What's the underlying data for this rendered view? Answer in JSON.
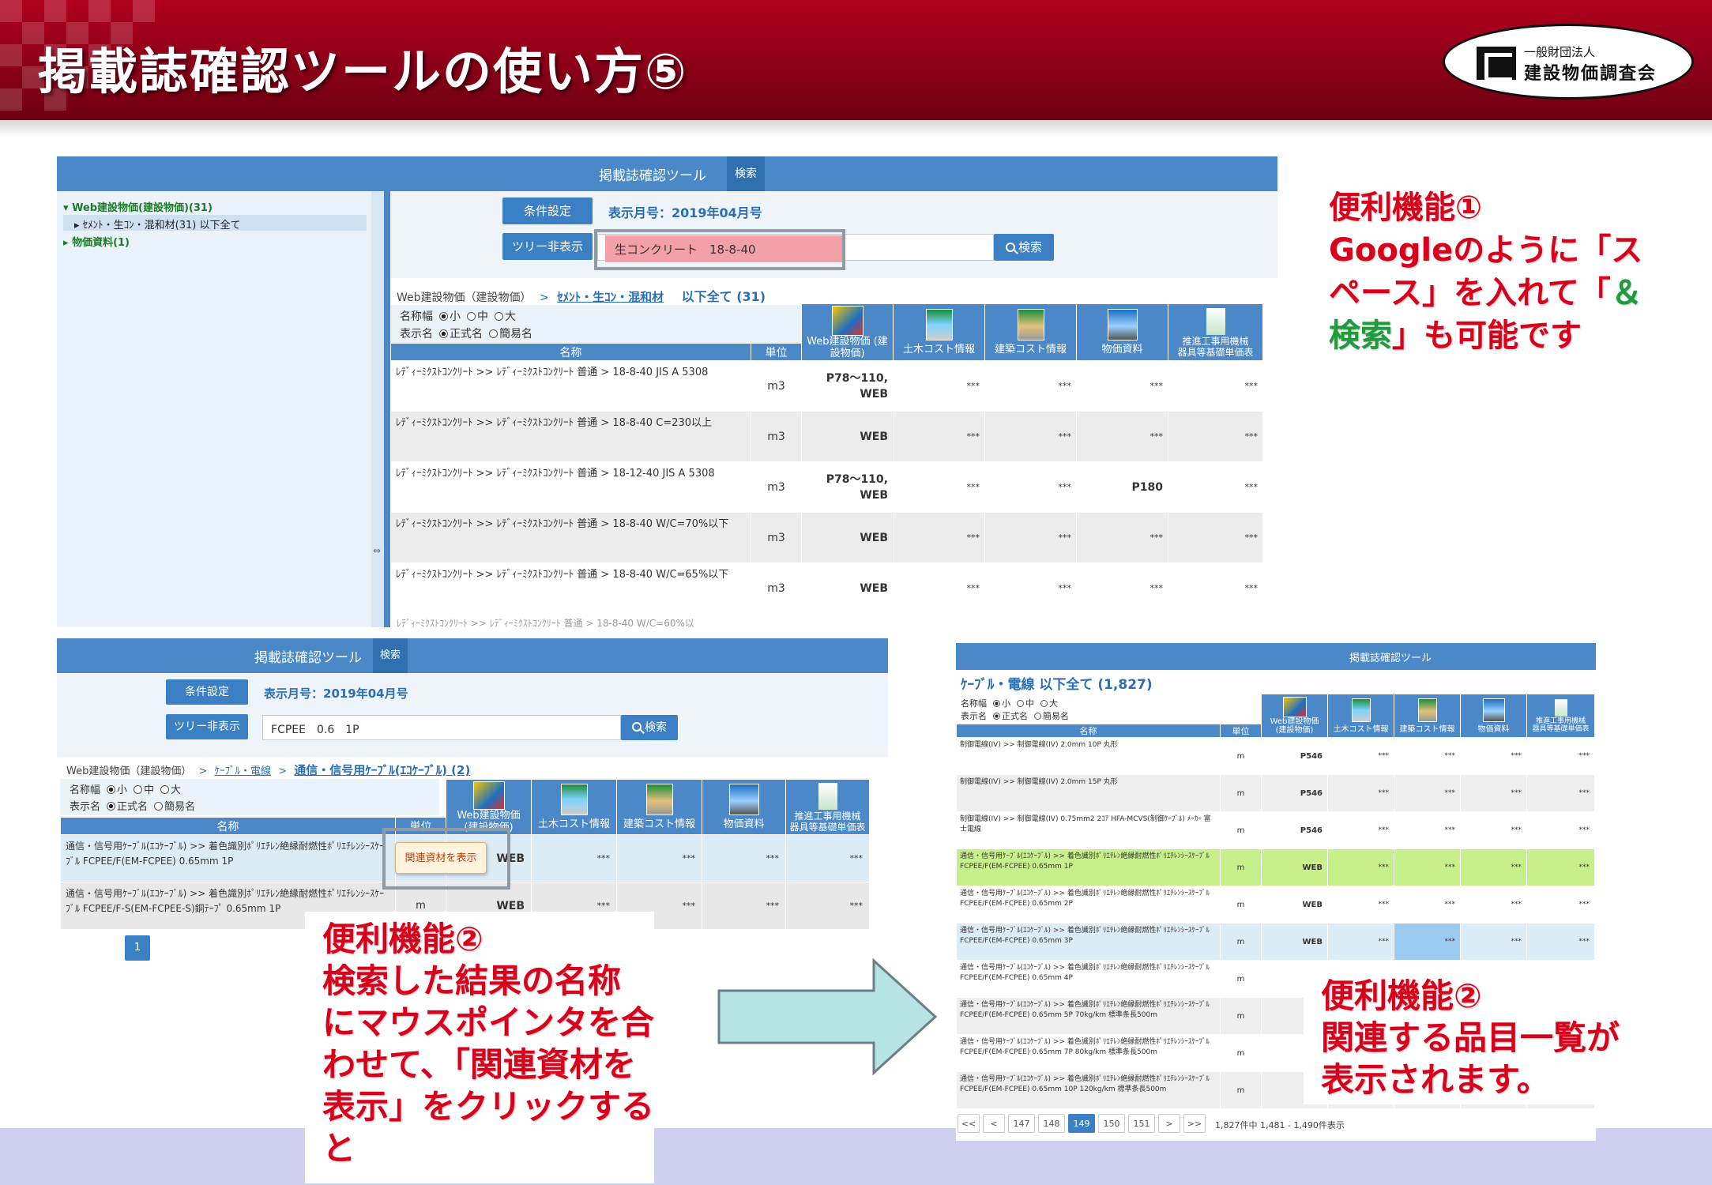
{
  "header": {
    "title": "掲載誌確認ツールの使い方⑤",
    "logo": {
      "line1": "一般財団法人",
      "line2": "建設物価調査会"
    }
  },
  "colors": {
    "header_red": "#9a001a",
    "tool_blue": "#4a88c7",
    "callout_red": "#d8001a",
    "callout_green": "#1f9a3c"
  },
  "tool1": {
    "title": "掲載誌確認ツール",
    "search_tab": "検索",
    "tree": {
      "root": "Web建設物価(建設物価)(31)",
      "child": "ｾﾒﾝﾄ・生ｺﾝ・混和材(31) 以下全て",
      "other": "物価資料(1)"
    },
    "condition_button": "条件設定",
    "month_label": "表示月号：2019年04月号",
    "tree_toggle_button": "ツリー非表示",
    "search_value": "生コンクリート　18-8-40",
    "search_button": "検索",
    "breadcrumb_root": "Web建設物価（建設物価）",
    "breadcrumb_sep": ">",
    "breadcrumb_cat": "ｾﾒﾝﾄ・生ｺﾝ・混和材",
    "breadcrumb_all": "以下全て (31)",
    "name_width_label": "名称幅",
    "name_width_opts": [
      "小",
      "中",
      "大"
    ],
    "display_label": "表示名",
    "display_opts": [
      "正式名",
      "簡易名"
    ],
    "col_name": "名称",
    "col_unit": "単位",
    "col_pubs": [
      "Web建設物価\n(建設物価)",
      "土木コスト情報",
      "建築コスト情報",
      "物価資料",
      "推進工事用機械\n器具等基礎単価表"
    ],
    "rows": [
      {
        "name": "ﾚﾃﾞｨｰﾐｸｽﾄｺﾝｸﾘｰﾄ >> ﾚﾃﾞｨｰﾐｸｽﾄｺﾝｸﾘｰﾄ 普通 > 18-8-40 JIS A 5308",
        "unit": "m3",
        "web": "P78～110,\nWEB",
        "doboku": "***",
        "kenchiku": "***",
        "bukka": "***",
        "suishin": "***"
      },
      {
        "name": "ﾚﾃﾞｨｰﾐｸｽﾄｺﾝｸﾘｰﾄ >> ﾚﾃﾞｨｰﾐｸｽﾄｺﾝｸﾘｰﾄ 普通 > 18-8-40 C=230以上",
        "unit": "m3",
        "web": "WEB",
        "doboku": "***",
        "kenchiku": "***",
        "bukka": "***",
        "suishin": "***"
      },
      {
        "name": "ﾚﾃﾞｨｰﾐｸｽﾄｺﾝｸﾘｰﾄ >> ﾚﾃﾞｨｰﾐｸｽﾄｺﾝｸﾘｰﾄ 普通 > 18-12-40 JIS A 5308",
        "unit": "m3",
        "web": "P78～110,\nWEB",
        "doboku": "***",
        "kenchiku": "***",
        "bukka": "P180",
        "suishin": "***"
      },
      {
        "name": "ﾚﾃﾞｨｰﾐｸｽﾄｺﾝｸﾘｰﾄ >> ﾚﾃﾞｨｰﾐｸｽﾄｺﾝｸﾘｰﾄ 普通 > 18-8-40 W/C=70%以下",
        "unit": "m3",
        "web": "WEB",
        "doboku": "***",
        "kenchiku": "***",
        "bukka": "***",
        "suishin": "***"
      },
      {
        "name": "ﾚﾃﾞｨｰﾐｸｽﾄｺﾝｸﾘｰﾄ >> ﾚﾃﾞｨｰﾐｸｽﾄｺﾝｸﾘｰﾄ 普通 > 18-8-40 W/C=65%以下",
        "unit": "m3",
        "web": "WEB",
        "doboku": "***",
        "kenchiku": "***",
        "bukka": "***",
        "suishin": "***"
      }
    ]
  },
  "tool2": {
    "title": "掲載誌確認ツール",
    "search_tab": "検索",
    "condition_button": "条件設定",
    "month_label": "表示月号：2019年04月号",
    "tree_toggle_button": "ツリー非表示",
    "search_value": "FCPEE　0.6　1P",
    "search_button": "検索",
    "breadcrumb_root": "Web建設物価（建設物価）",
    "breadcrumb_sep": ">",
    "breadcrumb_cat": "ｹｰﾌﾞﾙ・電線",
    "breadcrumb_sub": "通信・信号用ｹｰﾌﾞﾙ(ｴｺｹｰﾌﾞﾙ) (2)",
    "name_width_label": "名称幅",
    "name_width_opts": [
      "小",
      "中",
      "大"
    ],
    "display_label": "表示名",
    "display_opts": [
      "正式名",
      "簡易名"
    ],
    "col_name": "名称",
    "col_unit": "単位",
    "col_pubs": [
      "Web建設物価\n(建設物価)",
      "土木コスト情報",
      "建築コスト情報",
      "物価資料",
      "推進工事用機械\n器具等基礎単価表"
    ],
    "related_popup": "関連資材を表示",
    "rows": [
      {
        "name": "通信・信号用ｹｰﾌﾞﾙ(ｴｺｹｰﾌﾞﾙ) >> 着色識別ﾎﾟﾘｴﾁﾚﾝ絶縁耐燃性ﾎﾟﾘｴﾁﾚﾝｼｰｽｹｰﾌﾞﾙ FCPEE/F(EM-FCPEE) 0.65mm 1P",
        "unit": "m",
        "web": "WEB",
        "doboku": "***",
        "kenchiku": "***",
        "bukka": "***",
        "suishin": "***"
      },
      {
        "name": "通信・信号用ｹｰﾌﾞﾙ(ｴｺｹｰﾌﾞﾙ) >> 着色識別ﾎﾟﾘｴﾁﾚﾝ絶縁耐燃性ﾎﾟﾘｴﾁﾚﾝｼｰｽｹｰﾌﾞﾙ FCPEE/F-S(EM-FCPEE-S)銅ﾃｰﾌﾟ 0.65mm 1P",
        "unit": "m",
        "web": "WEB",
        "doboku": "***",
        "kenchiku": "***",
        "bukka": "***",
        "suishin": "***"
      }
    ],
    "page": "1"
  },
  "tool3": {
    "title": "掲載誌確認ツール",
    "heading": "ｹｰﾌﾞﾙ・電線 以下全て (1,827)",
    "name_width_label": "名称幅",
    "name_width_opts": [
      "小",
      "中",
      "大"
    ],
    "display_label": "表示名",
    "display_opts": [
      "正式名",
      "簡易名"
    ],
    "col_name": "名称",
    "col_unit": "単位",
    "col_pubs": [
      "Web建設物価\n(建設物価)",
      "土木コスト情報",
      "建築コスト情報",
      "物価資料",
      "推進工事用機械\n器具等基礎単価表"
    ],
    "rows": [
      {
        "name": "制御電線(IV) >> 制御電線(IV) 2.0mm 10P 丸形",
        "unit": "m",
        "web": "P546",
        "hl": ""
      },
      {
        "name": "制御電線(IV) >> 制御電線(IV) 2.0mm 15P 丸形",
        "unit": "m",
        "web": "P546",
        "hl": ""
      },
      {
        "name": "制御電線(IV) >> 制御電線(IV) 0.75mm2 2ｺｱ HFA-MCVS(制御ｹｰﾌﾞﾙ) ﾒｰｶｰ 富士電線",
        "unit": "m",
        "web": "P546",
        "hl": ""
      },
      {
        "name": "通信・信号用ｹｰﾌﾞﾙ(ｴｺｹｰﾌﾞﾙ) >> 着色識別ﾎﾟﾘｴﾁﾚﾝ絶縁耐燃性ﾎﾟﾘｴﾁﾚﾝｼｰｽｹｰﾌﾞﾙ FCPEE/F(EM-FCPEE) 0.65mm 1P",
        "unit": "m",
        "web": "WEB",
        "hl": "green"
      },
      {
        "name": "通信・信号用ｹｰﾌﾞﾙ(ｴｺｹｰﾌﾞﾙ) >> 着色識別ﾎﾟﾘｴﾁﾚﾝ絶縁耐燃性ﾎﾟﾘｴﾁﾚﾝｼｰｽｹｰﾌﾞﾙ FCPEE/F(EM-FCPEE) 0.65mm 2P",
        "unit": "m",
        "web": "WEB",
        "hl": ""
      },
      {
        "name": "通信・信号用ｹｰﾌﾞﾙ(ｴｺｹｰﾌﾞﾙ) >> 着色識別ﾎﾟﾘｴﾁﾚﾝ絶縁耐燃性ﾎﾟﾘｴﾁﾚﾝｼｰｽｹｰﾌﾞﾙ FCPEE/F(EM-FCPEE) 0.65mm 3P",
        "unit": "m",
        "web": "WEB",
        "hl": "blue"
      },
      {
        "name": "通信・信号用ｹｰﾌﾞﾙ(ｴｺｹｰﾌﾞﾙ) >> 着色識別ﾎﾟﾘｴﾁﾚﾝ絶縁耐燃性ﾎﾟﾘｴﾁﾚﾝｼｰｽｹｰﾌﾞﾙ FCPEE/F(EM-FCPEE) 0.65mm 4P",
        "unit": "m",
        "web": "",
        "hl": ""
      },
      {
        "name": "通信・信号用ｹｰﾌﾞﾙ(ｴｺｹｰﾌﾞﾙ) >> 着色識別ﾎﾟﾘｴﾁﾚﾝ絶縁耐燃性ﾎﾟﾘｴﾁﾚﾝｼｰｽｹｰﾌﾞﾙ FCPEE/F(EM-FCPEE) 0.65mm 5P 70kg/km 標準条長500m",
        "unit": "m",
        "web": "",
        "hl": ""
      },
      {
        "name": "通信・信号用ｹｰﾌﾞﾙ(ｴｺｹｰﾌﾞﾙ) >> 着色識別ﾎﾟﾘｴﾁﾚﾝ絶縁耐燃性ﾎﾟﾘｴﾁﾚﾝｼｰｽｹｰﾌﾞﾙ FCPEE/F(EM-FCPEE) 0.65mm 7P 80kg/km 標準条長500m",
        "unit": "m",
        "web": "",
        "hl": ""
      },
      {
        "name": "通信・信号用ｹｰﾌﾞﾙ(ｴｺｹｰﾌﾞﾙ) >> 着色識別ﾎﾟﾘｴﾁﾚﾝ絶縁耐燃性ﾎﾟﾘｴﾁﾚﾝｼｰｽｹｰﾌﾞﾙ FCPEE/F(EM-FCPEE) 0.65mm 10P 120kg/km 標準条長500m",
        "unit": "m",
        "web": "",
        "hl": ""
      }
    ],
    "pager": [
      "<<",
      "<",
      "147",
      "148",
      "149",
      "150",
      "151",
      ">",
      ">>"
    ],
    "pager_active": "149",
    "pager_info": "1,827件中 1,481 - 1,490件表示",
    "stars": "***"
  },
  "callout1": {
    "line1": "便利機能①",
    "line2": "Googleのように「ス",
    "line3": "ペース」を入れて「",
    "line3_green": "＆",
    "line4_green": "検索",
    "line4": "」も可能です"
  },
  "callout2": {
    "line1": "便利機能②",
    "line2": "検索した結果の名称",
    "line3": "にマウスポインタを合",
    "line4": "わせて、「関連資材を",
    "line5": "表示」をクリックする",
    "line6": "と"
  },
  "callout3": {
    "line1": "便利機能②",
    "line2": "関連する品目一覧が",
    "line3": "表示されます。"
  }
}
